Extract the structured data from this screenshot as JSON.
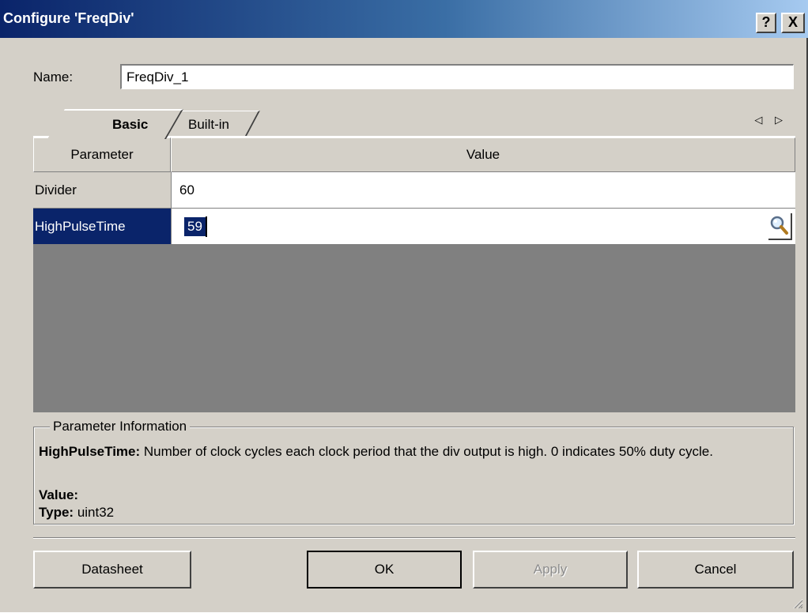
{
  "window": {
    "title": "Configure 'FreqDiv'",
    "help_glyph": "?",
    "close_glyph": "X"
  },
  "name": {
    "label": "Name:",
    "value": "FreqDiv_1"
  },
  "tabs": [
    {
      "label": "Basic",
      "selected": true
    },
    {
      "label": "Built-in",
      "selected": false
    }
  ],
  "tab_scroll": "◁ ▷",
  "grid": {
    "headers": {
      "parameter": "Parameter",
      "value": "Value"
    },
    "rows": [
      {
        "parameter": "Divider",
        "value": "60"
      },
      {
        "parameter": "HighPulseTime",
        "value": "59"
      }
    ]
  },
  "info": {
    "legend": "Parameter Information",
    "param_name": "HighPulseTime",
    "description": " Number of clock cycles each clock period that the div output is high. 0 indicates 50% duty cycle.",
    "value_label": "Value",
    "value_text": "",
    "type_label": "Type",
    "type_text": " uint32"
  },
  "buttons": {
    "datasheet": "Datasheet",
    "ok": "OK",
    "apply": "Apply",
    "cancel": "Cancel"
  },
  "colors": {
    "selection": "#0a246a",
    "face": "#d4d0c8",
    "empty_grid": "#808080"
  },
  "icons": {
    "lookup": "magnifier-icon",
    "resize": "resize-grip-icon"
  }
}
